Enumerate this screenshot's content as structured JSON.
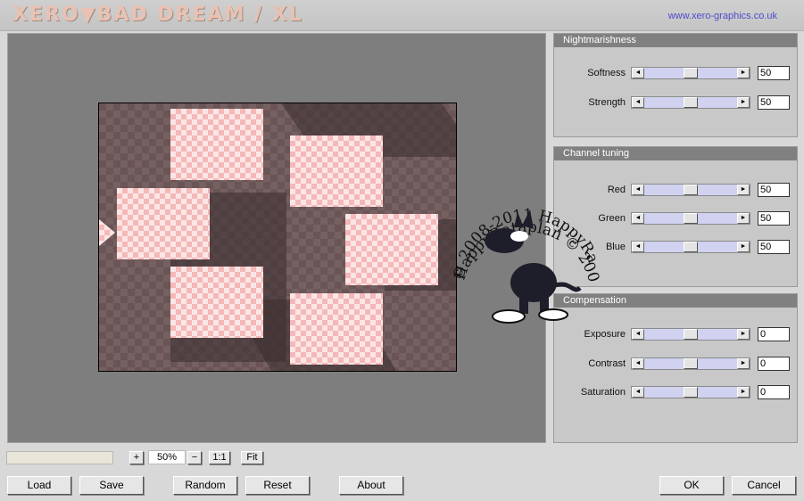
{
  "header": {
    "logo_text": "XERO▼BAD DREAM / XL",
    "url": "www.xero-graphics.co.uk"
  },
  "panels": [
    {
      "title": "Nightmarishness",
      "rows": [
        {
          "label": "Softness",
          "value": "50",
          "level": 0.5
        },
        {
          "label": "Strength",
          "value": "50",
          "level": 0.5
        }
      ]
    },
    {
      "title": "Channel tuning",
      "rows": [
        {
          "label": "Red",
          "value": "50",
          "level": 0.5
        },
        {
          "label": "Green",
          "value": "50",
          "level": 0.5
        },
        {
          "label": "Blue",
          "value": "50",
          "level": 0.5
        }
      ]
    },
    {
      "title": "Compensation",
      "rows": [
        {
          "label": "Exposure",
          "value": "0",
          "level": 0.5
        },
        {
          "label": "Contrast",
          "value": "0",
          "level": 0.5
        },
        {
          "label": "Saturation",
          "value": "0",
          "level": 0.5
        }
      ]
    }
  ],
  "zoom": {
    "plus_label": "+",
    "value": "50%",
    "minus_label": "−",
    "actual_label": "1:1",
    "fit_label": "Fit"
  },
  "buttons": {
    "load": "Load",
    "save": "Save",
    "random": "Random",
    "reset": "Reset",
    "about": "About",
    "ok": "OK",
    "cancel": "Cancel"
  },
  "watermark": {
    "text_top": "© 2008-2011  HappyRatafplan",
    "text_bottom": "HappyRataplan © 2008-2011"
  },
  "icons": {
    "slider_left": "arrow-left-icon",
    "slider_right": "arrow-right-icon"
  },
  "colors": {
    "panel_header": "#808080",
    "slider_track": "#d0d2f0",
    "url": "#4c4ccf",
    "tile": "#f5b8b8"
  }
}
